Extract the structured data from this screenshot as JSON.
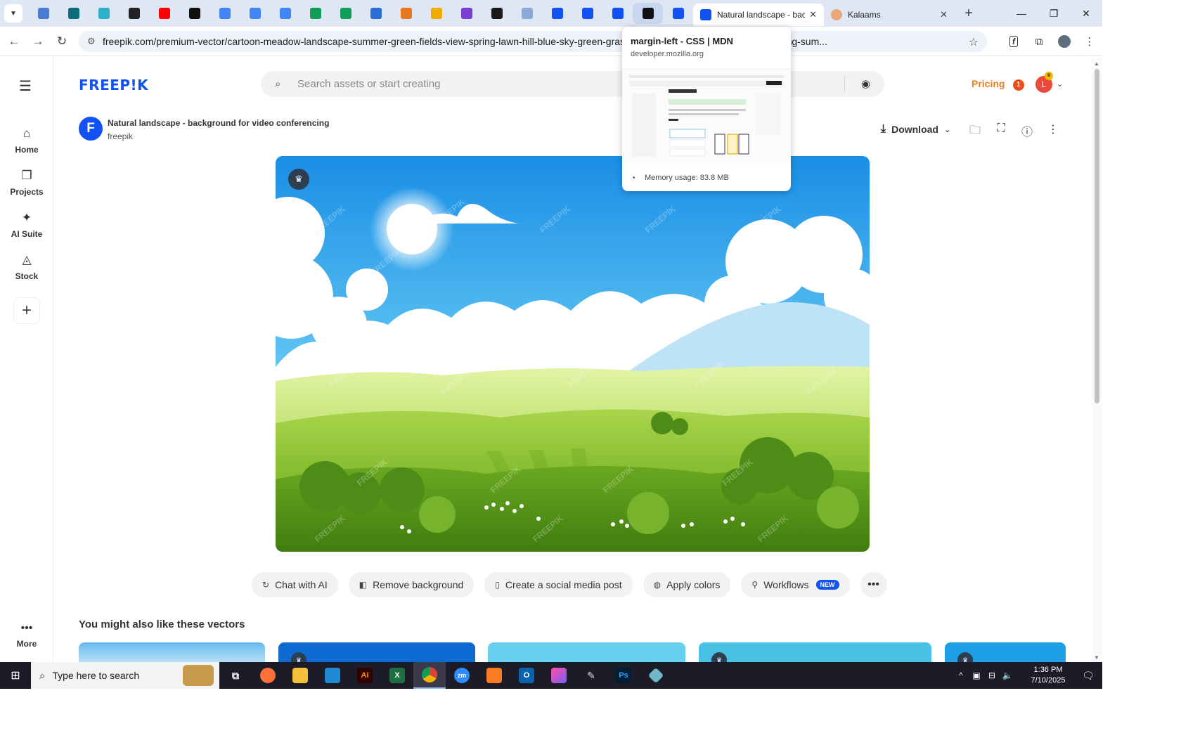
{
  "browser": {
    "pinned_tabs": [
      {
        "name": "pinned-tab-1",
        "color": "#4a7bd0"
      },
      {
        "name": "pinned-tab-2",
        "color": "#0a6e7a"
      },
      {
        "name": "pinned-tab-3",
        "color": "#2bb0c8"
      },
      {
        "name": "pinned-tab-4",
        "color": "#222222"
      },
      {
        "name": "pinned-tab-youtube",
        "color": "#ff0000"
      },
      {
        "name": "pinned-tab-6",
        "color": "#111111"
      },
      {
        "name": "pinned-tab-docs-1",
        "color": "#4285f4"
      },
      {
        "name": "pinned-tab-docs-2",
        "color": "#4285f4"
      },
      {
        "name": "pinned-tab-docs-3",
        "color": "#4285f4"
      },
      {
        "name": "pinned-tab-sheets-1",
        "color": "#0f9d58"
      },
      {
        "name": "pinned-tab-sheets-2",
        "color": "#0f9d58"
      },
      {
        "name": "pinned-tab-12",
        "color": "#2a6fd6"
      },
      {
        "name": "pinned-tab-13",
        "color": "#e87722"
      },
      {
        "name": "pinned-tab-14",
        "color": "#f2a900"
      },
      {
        "name": "pinned-tab-15",
        "color": "#7b3fd1"
      },
      {
        "name": "pinned-tab-16",
        "color": "#1a1a1a"
      },
      {
        "name": "pinned-tab-17",
        "color": "#8aa8d8"
      },
      {
        "name": "pinned-tab-freepik-1",
        "color": "#1252f3"
      },
      {
        "name": "pinned-tab-freepik-2",
        "color": "#1252f3"
      },
      {
        "name": "pinned-tab-freepik-3",
        "color": "#1252f3"
      },
      {
        "name": "pinned-tab-mdn",
        "color": "#111111"
      },
      {
        "name": "pinned-tab-freepik-4",
        "color": "#1252f3"
      }
    ],
    "active_tab_title": "Natural landscape - backg",
    "second_tab_title": "Kalaams",
    "url": "freepik.com/premium-vector/cartoon-meadow-landscape-summer-green-fields-view-spring-lawn-hill-blue-sky-green-grass-field-grass-meadow-landscape-spring-sum...",
    "hover_card": {
      "title": "margin-left - CSS | MDN",
      "domain": "developer.mozilla.org",
      "memory": "Memory usage: 83.8 MB"
    }
  },
  "freepik": {
    "logo": "FREEP!K",
    "search_placeholder": "Search assets or start creating",
    "pricing": "Pricing",
    "notification_count": "1",
    "avatar_initial": "L",
    "sidebar": {
      "home": "Home",
      "projects": "Projects",
      "ai_suite": "AI Suite",
      "stock": "Stock",
      "more": "More"
    },
    "asset": {
      "author_logo_letter": "F",
      "title": "Natural landscape - background for video conferencing",
      "author": "freepik",
      "download_label": "Download"
    },
    "tools": [
      {
        "name": "chat-with-ai-button",
        "icon": "↻",
        "label": "Chat with AI"
      },
      {
        "name": "remove-background-button",
        "icon": "◧",
        "label": "Remove background"
      },
      {
        "name": "create-social-media-post-button",
        "icon": "▯",
        "label": "Create a social media post"
      },
      {
        "name": "apply-colors-button",
        "icon": "◍",
        "label": "Apply colors"
      },
      {
        "name": "workflows-button",
        "icon": "⚲",
        "label": "Workflows",
        "badge": "NEW"
      }
    ],
    "related_title": "You might also like these vectors",
    "watermark": "FREEPIK"
  },
  "taskbar": {
    "search_placeholder": "Type here to search",
    "time": "1:36 PM",
    "date": "7/10/2025"
  }
}
